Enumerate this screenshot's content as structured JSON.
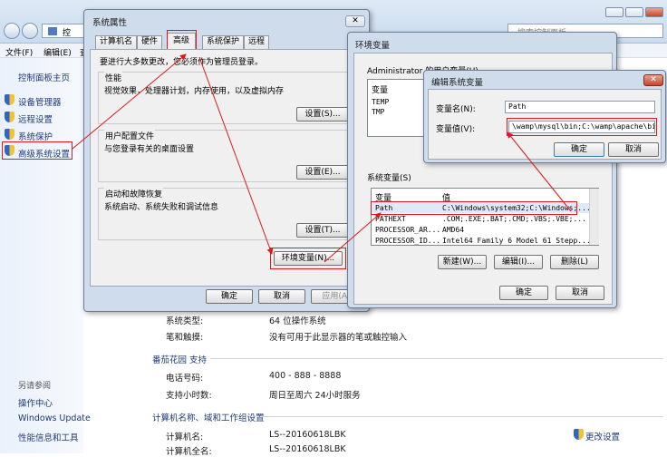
{
  "control_panel": {
    "address_partial": "控",
    "search_placeholder": "搜索控制面板",
    "menu": {
      "file": "文件(F)",
      "edit": "编辑(E)",
      "view": "查"
    },
    "left_links": {
      "home": "控制面板主页",
      "device_manager": "设备管理器",
      "remote": "远程设置",
      "protection": "系统保护",
      "advanced": "高级系统设置"
    },
    "see_also": {
      "heading": "另请参阅",
      "action_center": "操作中心",
      "windows_update": "Windows Update",
      "perf": "性能信息和工具"
    },
    "info": {
      "system_type_label": "系统类型:",
      "system_type_value": "64 位操作系统",
      "pen_label": "笔和触摸:",
      "pen_value": "没有可用于此显示器的笔或触控输入",
      "support_heading": "番茄花园 支持",
      "phone_label": "电话号码:",
      "phone_value": "400 - 888 - 8888",
      "hours_label": "支持小时数:",
      "hours_value": "周日至周六  24小时服务",
      "computer_heading": "计算机名称、域和工作组设置",
      "name_label": "计算机名:",
      "name_value": "LS--20160618LBK",
      "full_label": "计算机全名:",
      "full_value": "LS--20160618LBK",
      "change_link": "更改设置"
    }
  },
  "sys_props": {
    "title": "系统属性",
    "close": "✕",
    "tabs": [
      "计算机名",
      "硬件",
      "高级",
      "系统保护",
      "远程"
    ],
    "admin_note": "要进行大多数更改，您必须作为管理员登录。",
    "perf_title": "性能",
    "perf_desc": "视觉效果，处理器计划，内存使用，以及虚拟内存",
    "profile_title": "用户配置文件",
    "profile_desc": "与您登录有关的桌面设置",
    "startup_title": "启动和故障恢复",
    "startup_desc": "系统启动、系统失败和调试信息",
    "settings_s": "设置(S)...",
    "settings_e": "设置(E)...",
    "settings_t": "设置(T)...",
    "env_button": "环境变量(N)...",
    "ok": "确定",
    "cancel": "取消",
    "apply": "应用(A)"
  },
  "env_vars": {
    "title": "环境变量",
    "user_label_partial": "Administrator 的用户变量(U)",
    "col_var": "变量",
    "col_val": "值",
    "user_vars": [
      "TEMP",
      "TMP"
    ],
    "sys_label": "系统变量(S)",
    "sys_rows": [
      {
        "name": "Path",
        "value": "C:\\Windows\\system32;C:\\Windows;..."
      },
      {
        "name": "PATHEXT",
        "value": ".COM;.EXE;.BAT;.CMD;.VBS;.VBE;..."
      },
      {
        "name": "PROCESSOR_AR...",
        "value": "AMD64"
      },
      {
        "name": "PROCESSOR_ID...",
        "value": "Intel64 Family 6 Model 61 Stepp..."
      }
    ],
    "new": "新建(W)...",
    "edit": "编辑(I)...",
    "delete": "删除(L)",
    "ok": "确定",
    "cancel": "取消"
  },
  "edit_var": {
    "title": "编辑系统变量",
    "name_label": "变量名(N):",
    "name_value": "Path",
    "value_label": "变量值(V):",
    "value_value": "\\wamp\\mysql\\bin;C:\\wamp\\apache\\bin;",
    "ok": "确定",
    "cancel": "取消"
  }
}
